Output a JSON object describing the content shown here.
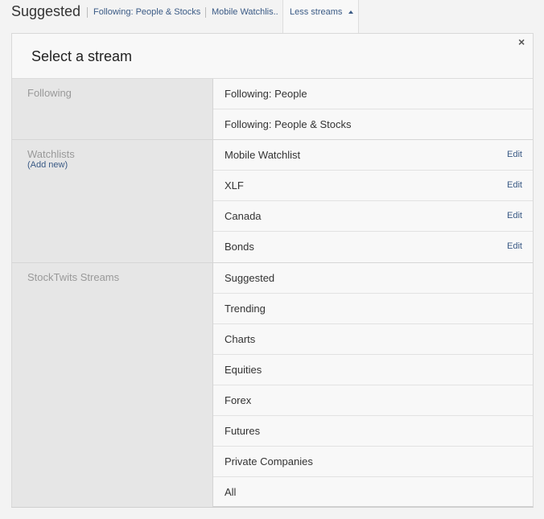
{
  "header": {
    "title": "Suggested",
    "links": [
      "Following: People & Stocks",
      "Mobile Watchlis.."
    ],
    "tab_label": "Less streams"
  },
  "panel": {
    "title": "Select a stream",
    "close_glyph": "×"
  },
  "sections": {
    "following": {
      "name": "Following",
      "items": [
        "Following: People",
        "Following: People & Stocks"
      ]
    },
    "watchlists": {
      "name": "Watchlists",
      "add_new": "(Add new)",
      "edit_label": "Edit",
      "items": [
        "Mobile Watchlist",
        "XLF",
        "Canada",
        "Bonds"
      ]
    },
    "streams": {
      "name": "StockTwits Streams",
      "items": [
        "Suggested",
        "Trending",
        "Charts",
        "Equities",
        "Forex",
        "Futures",
        "Private Companies",
        "All"
      ]
    }
  }
}
